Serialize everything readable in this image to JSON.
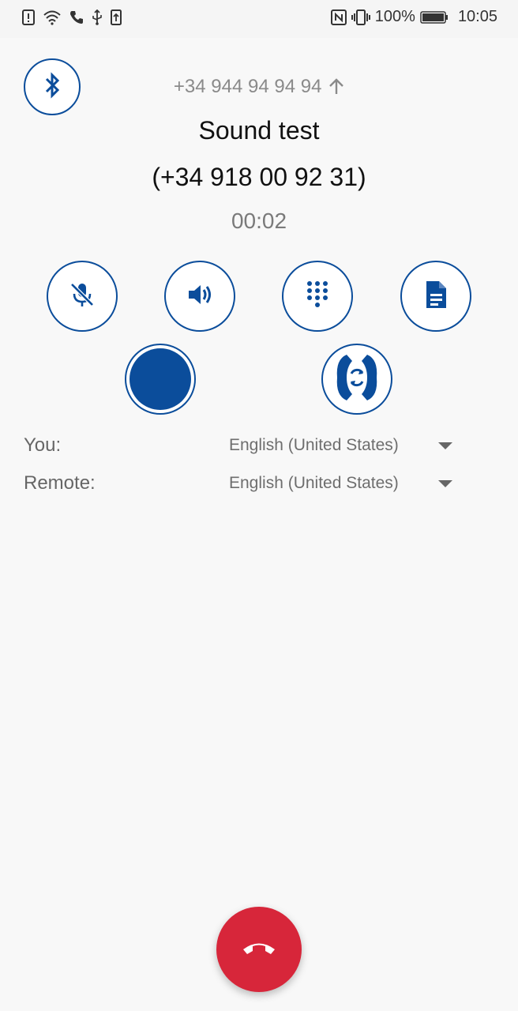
{
  "status_bar": {
    "battery_percent": "100%",
    "time": "10:05",
    "left_icons": [
      "alert-icon",
      "wifi-icon",
      "phone-call-icon",
      "usb-icon",
      "upload-icon"
    ],
    "right_icons": [
      "nfc-icon",
      "vibrate-icon",
      "battery-icon"
    ]
  },
  "call": {
    "from_number": "+34 944 94 94 94",
    "contact_name": "Sound test",
    "contact_number": "(+34 918 00 92 31)",
    "duration": "00:02"
  },
  "controls": [
    "mute-icon",
    "speaker-icon",
    "dialpad-icon",
    "notes-icon",
    "record-icon",
    "transfer-icon"
  ],
  "languages": {
    "you_label": "You:",
    "you_value": "English (United States)",
    "remote_label": "Remote:",
    "remote_value": "English (United States)"
  },
  "colors": {
    "accent": "#0b4d9b",
    "hangup": "#d7263a",
    "background": "#f8f8f8"
  }
}
